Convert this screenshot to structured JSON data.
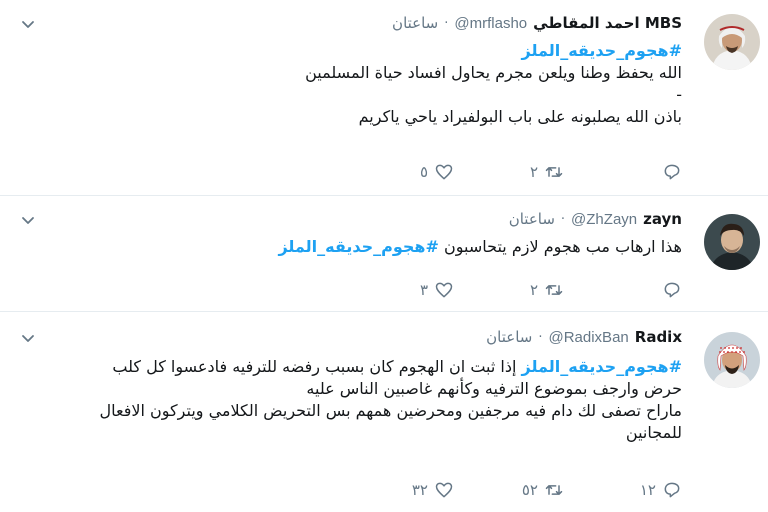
{
  "tweets": [
    {
      "name": "احمد المقاطي MBS",
      "handle": "@mrflasho",
      "time": "ساعتان",
      "hashtag": "#هجوم_حديقه_الملز",
      "lines": [
        "الله يحفظ وطنا ويلعن مجرم يحاول افساد حياة المسلمين",
        "-",
        "باذن الله يصلبونه على باب البولفيراد ياحي ياكريم"
      ],
      "replies": "",
      "retweets": "٢",
      "likes": "٥"
    },
    {
      "name": "zayn",
      "handle": "@ZhZayn",
      "time": "ساعتان",
      "text_before": "هذا ارهاب مب هجوم لازم يتحاسبون ",
      "hashtag": "#هجوم_حديقه_الملز",
      "replies": "",
      "retweets": "٢",
      "likes": "٣"
    },
    {
      "name": "Radix",
      "handle": "@RadixBan",
      "time": "ساعتان",
      "hashtag": "#هجوم_حديقه_الملز",
      "first_line_rest": " إذا ثبت ان الهجوم كان بسبب رفضه للترفيه فادعسوا كل كلب",
      "lines": [
        "حرض وارجف بموضوع الترفيه وكأنهم غاصبين الناس عليه",
        "ماراح تصفى لك دام فيه مرجفين ومحرضين همهم بس التحريض الكلامي ويتركون الافعال",
        "للمجانين"
      ],
      "replies": "١٢",
      "retweets": "٥٢",
      "likes": "٣٢"
    }
  ],
  "icons": {
    "reply": "reply-icon",
    "retweet": "retweet-icon",
    "like": "heart-icon",
    "more": "chevron-down-icon"
  },
  "colors": {
    "hashtag": "#1da1f2",
    "muted": "#657786",
    "divider": "#e6ecf0"
  }
}
